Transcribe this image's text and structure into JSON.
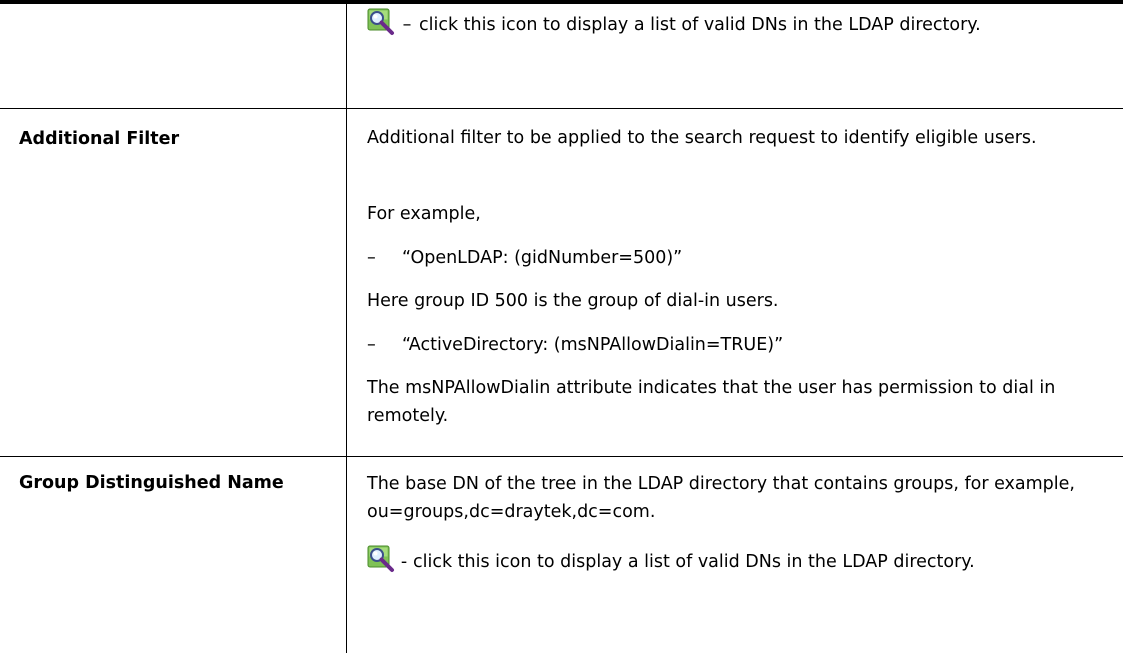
{
  "top_row": {
    "icon": "magnifier-icon",
    "icon_note_dash": "–",
    "icon_note": "click this icon to display a list of valid DNs in the LDAP directory."
  },
  "additional_filter": {
    "term": "Additional Filter",
    "description": "Additional filter to be applied to the search request to identify eligible users.",
    "example_intro": "For example,",
    "example1_dash": "–",
    "example1": "“OpenLDAP: (gidNumber=500)”",
    "example1_note": "Here group ID 500 is the group of dial-in users.",
    "example2_dash": "–",
    "example2": "“ActiveDirectory: (msNPAllowDialin=TRUE)”",
    "example2_note": "The msNPAllowDialin attribute indicates that the user has permission to dial in remotely."
  },
  "group_dn": {
    "term": "Group Distinguished Name",
    "description": "The base DN of the tree in the LDAP directory that contains groups, for example, ou=groups,dc=draytek,dc=com.",
    "icon": "magnifier-icon",
    "icon_note_dash": "-",
    "icon_note": "click this icon to display a list of valid DNs in the LDAP directory."
  }
}
